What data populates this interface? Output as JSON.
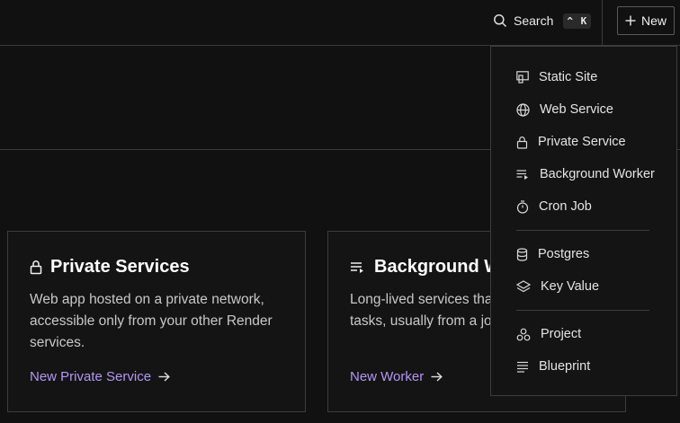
{
  "header": {
    "search_label": "Search",
    "search_shortcut": "^ K",
    "new_label": "New"
  },
  "cards": [
    {
      "title": "Private Services",
      "description": "Web app hosted on a private network, accessible only from your other Render services.",
      "link": "New Private Service",
      "icon": "lock-icon"
    },
    {
      "title": "Background Workers",
      "description": "Long-lived services that process async tasks, usually from a job queue.",
      "link": "New Worker",
      "icon": "list-arrow-icon"
    }
  ],
  "menu": {
    "items": [
      {
        "label": "Static Site",
        "icon": "static-site-icon"
      },
      {
        "label": "Web Service",
        "icon": "globe-icon"
      },
      {
        "label": "Private Service",
        "icon": "lock-icon"
      },
      {
        "label": "Background Worker",
        "icon": "list-arrow-icon"
      },
      {
        "label": "Cron Job",
        "icon": "stopwatch-icon"
      },
      {
        "label": "Postgres",
        "icon": "database-icon"
      },
      {
        "label": "Key Value",
        "icon": "layers-icon"
      },
      {
        "label": "Project",
        "icon": "project-icon"
      },
      {
        "label": "Blueprint",
        "icon": "blueprint-icon"
      }
    ]
  }
}
